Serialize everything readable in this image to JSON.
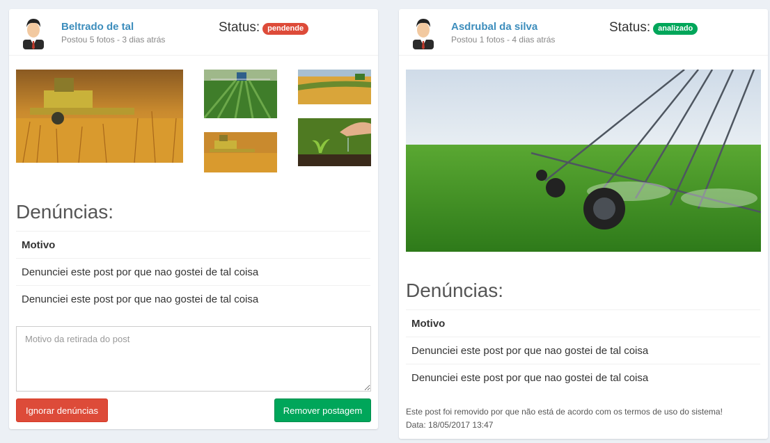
{
  "posts": [
    {
      "user": "Beltrado de tal",
      "info": "Postou 5 fotos - 3 dias atrás",
      "status_label": "Status:",
      "status_badge": "pendende",
      "status_color": "#dd4b39",
      "reports_title": "Denúncias:",
      "reports_header": "Motivo",
      "reports": [
        "Denunciei este post por que nao gostei de tal coisa",
        "Denunciei este post por que nao gostei de tal coisa"
      ],
      "textarea_placeholder": "Motivo da retirada do post",
      "ignore_button": "Ignorar denúncias",
      "remove_button": "Remover postagem"
    },
    {
      "user": "Asdrubal da silva",
      "info": "Postou 1 fotos - 4 dias atrás",
      "status_label": "Status:",
      "status_badge": "analizado",
      "status_color": "#00a65a",
      "reports_title": "Denúncias:",
      "reports_header": "Motivo",
      "reports": [
        "Denunciei este post por que nao gostei de tal coisa",
        "Denunciei este post por que nao gostei de tal coisa"
      ],
      "removal_note": "Este post foi removido por que não está de acordo com os termos de uso do sistema!",
      "removal_date": "Data: 18/05/2017 13:47"
    }
  ]
}
